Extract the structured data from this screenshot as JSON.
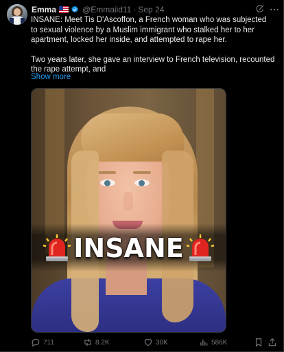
{
  "post": {
    "author_name": "Emma",
    "handle": "@Emmaiid11",
    "separator": "·",
    "date": "Sep 24",
    "text_p1": "INSANE: Meet Tis D'Ascoffon, a French woman who was subjected to sexual violence by a Muslim immigrant who stalked her to her apartment, locked her inside, and attempted to rape her.",
    "text_p2": "Two years later, she gave an interview to French television, recounted the rape attempt, and",
    "show_more": "Show more"
  },
  "media": {
    "caption": "INSANE",
    "caption_icon": "police-light-emoji"
  },
  "actions": {
    "replies": "711",
    "reposts": "8.2K",
    "likes": "30K",
    "views": "586K"
  },
  "icons": [
    "grok-icon",
    "more-icon",
    "verified-badge-icon",
    "us-flag-icon",
    "reply-icon",
    "repost-icon",
    "like-icon",
    "views-icon",
    "bookmark-icon",
    "share-icon"
  ],
  "colors": {
    "background": "#000000",
    "text": "#e7e9ea",
    "muted": "#71767b",
    "link": "#1d9bf0",
    "verified": "#1d9bf0"
  }
}
